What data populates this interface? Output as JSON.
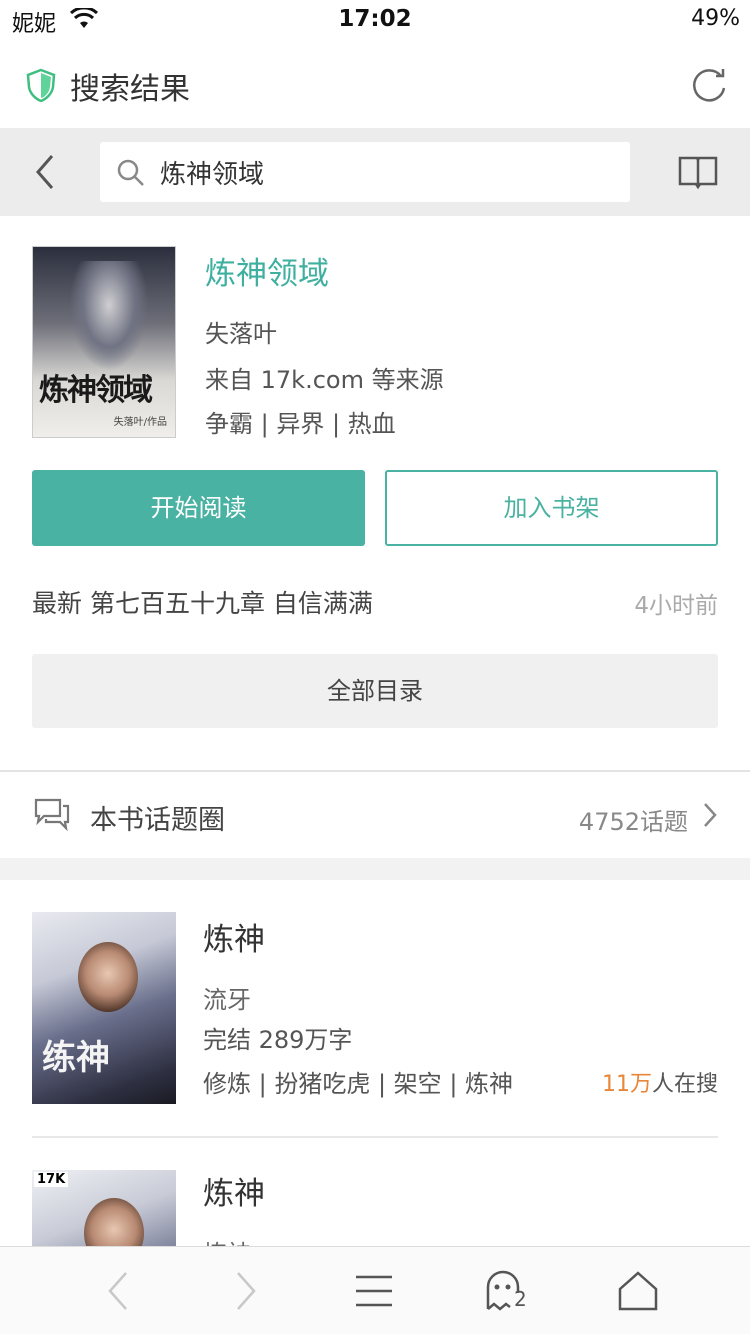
{
  "status_bar": {
    "carrier": "妮妮",
    "time": "17:02",
    "battery": "49%"
  },
  "header": {
    "title": "搜索结果"
  },
  "search": {
    "value": "炼神领域"
  },
  "featured": {
    "title": "炼神领域",
    "author": "失落叶",
    "source": "来自 17k.com 等来源",
    "tags": "争霸 | 异界 | 热血",
    "cover_title": "炼神领域",
    "cover_author": "失落叶/作品",
    "read_label": "开始阅读",
    "shelf_label": "加入书架",
    "latest_prefix": "最新",
    "latest_chapter": "第七百五十九章 自信满满",
    "latest_time": "4小时前",
    "toc_label": "全部目录"
  },
  "topic": {
    "label": "本书话题圈",
    "count": "4752话题"
  },
  "results": [
    {
      "title": "炼神",
      "author": "流牙",
      "status": "完结  289万字",
      "tags": "修炼 | 扮猪吃虎 | 架空 | 炼神",
      "hot_num": "11万",
      "hot_suffix": "人在搜",
      "cover_title": "练神"
    },
    {
      "title": "炼神",
      "author": "炼神",
      "cover_logo": "17K"
    }
  ],
  "toolbar": {
    "ghost_count": "2"
  },
  "colors": {
    "accent": "#4ab2a2",
    "hot": "#e8873a"
  }
}
